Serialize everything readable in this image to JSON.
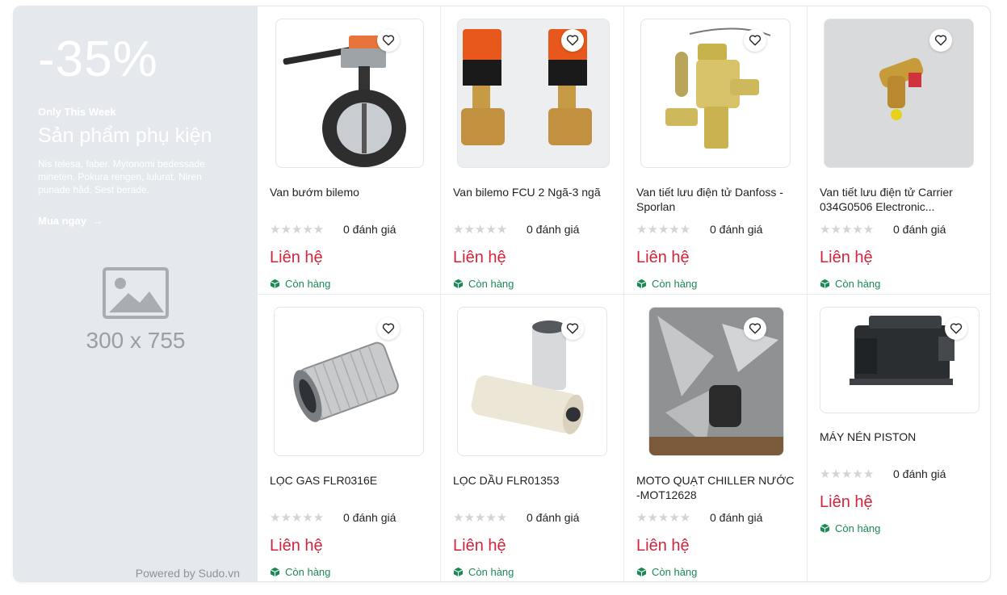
{
  "banner": {
    "discount": "-35%",
    "tagline": "Only This Week",
    "title": "Sản phẩm phụ kiện",
    "description": "Nis telesa, faber. Mytonomi bedessade mineten. Pokura rengen, lulurat. Niren punade håd. Sest berade.",
    "cta": "Mua ngay",
    "placeholder": "300 x 755",
    "powered_by": "Powered by Sudo.vn"
  },
  "products": [
    {
      "name": "Van bướm bilemo",
      "rating": "0 đánh giá",
      "price": "Liên hệ",
      "stock": "Còn hàng",
      "image": "butterfly-valve"
    },
    {
      "name": "Van bilemo FCU 2 Ngã-3 ngã",
      "rating": "0 đánh giá",
      "price": "Liên hệ",
      "stock": "Còn hàng",
      "image": "fcu-valve"
    },
    {
      "name": "Van tiết lưu điện tử Danfoss -Sporlan",
      "rating": "0 đánh giá",
      "price": "Liên hệ",
      "stock": "Còn hàng",
      "image": "expansion-valve"
    },
    {
      "name": "Van tiết lưu điện tử Carrier 034G0506 Electronic...",
      "rating": "0 đánh giá",
      "price": "Liên hệ",
      "stock": "Còn hàng",
      "image": "brass-valve"
    },
    {
      "name": "LỌC GAS FLR0316E",
      "rating": "0 đánh giá",
      "price": "Liên hệ",
      "stock": "Còn hàng",
      "image": "gas-filter"
    },
    {
      "name": "LỌC DẦU FLR01353",
      "rating": "0 đánh giá",
      "price": "Liên hệ",
      "stock": "Còn hàng",
      "image": "oil-filter"
    },
    {
      "name": "MOTO QUẠT CHILLER NƯỚC -MOT12628",
      "rating": "0 đánh giá",
      "price": "Liên hệ",
      "stock": "Còn hàng",
      "image": "fan-motor"
    },
    {
      "name": "MÁY NÉN PISTON",
      "rating": "0 đánh giá",
      "price": "Liên hệ",
      "stock": "Còn hàng",
      "image": "piston-compressor"
    }
  ],
  "colors": {
    "price": "#d0243c",
    "stock": "#1a8a55",
    "banner_bg": "#e5e9ee"
  }
}
